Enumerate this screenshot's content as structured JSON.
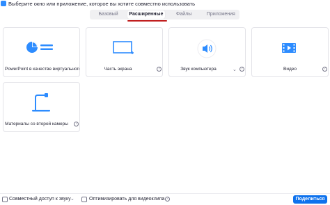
{
  "window": {
    "title": "Выберите окно или приложение, которое вы хотите совместно использовать"
  },
  "tabs": [
    {
      "label": "Базовый",
      "active": false
    },
    {
      "label": "Расширенные",
      "active": true
    },
    {
      "label": "Файлы",
      "active": false
    },
    {
      "label": "Приложения",
      "active": false
    }
  ],
  "tiles": [
    {
      "label": "PowerPoint в качестве виртуального ф...",
      "icon": "powerpoint-background-icon"
    },
    {
      "label": "Часть экрана",
      "icon": "screen-portion-icon",
      "help": "?"
    },
    {
      "label": "Звук компьютера",
      "icon": "computer-audio-icon",
      "help": "?",
      "dropdown": "⌄"
    },
    {
      "label": "Видео",
      "icon": "video-icon",
      "help": "?"
    },
    {
      "label": "Материалы со второй камеры",
      "icon": "second-camera-icon",
      "help": "?"
    }
  ],
  "bottom": {
    "share_audio_label": "Совместный доступ к звуку",
    "share_audio_dropdown": "⌄",
    "optimize_video_label": "Оптимизировать для видеоклипа",
    "optimize_help": "?",
    "share_button": "Поделиться"
  },
  "colors": {
    "accent": "#0e72ed",
    "tab_underline": "#c11f1f",
    "icon_blue": "#2d8cff"
  }
}
